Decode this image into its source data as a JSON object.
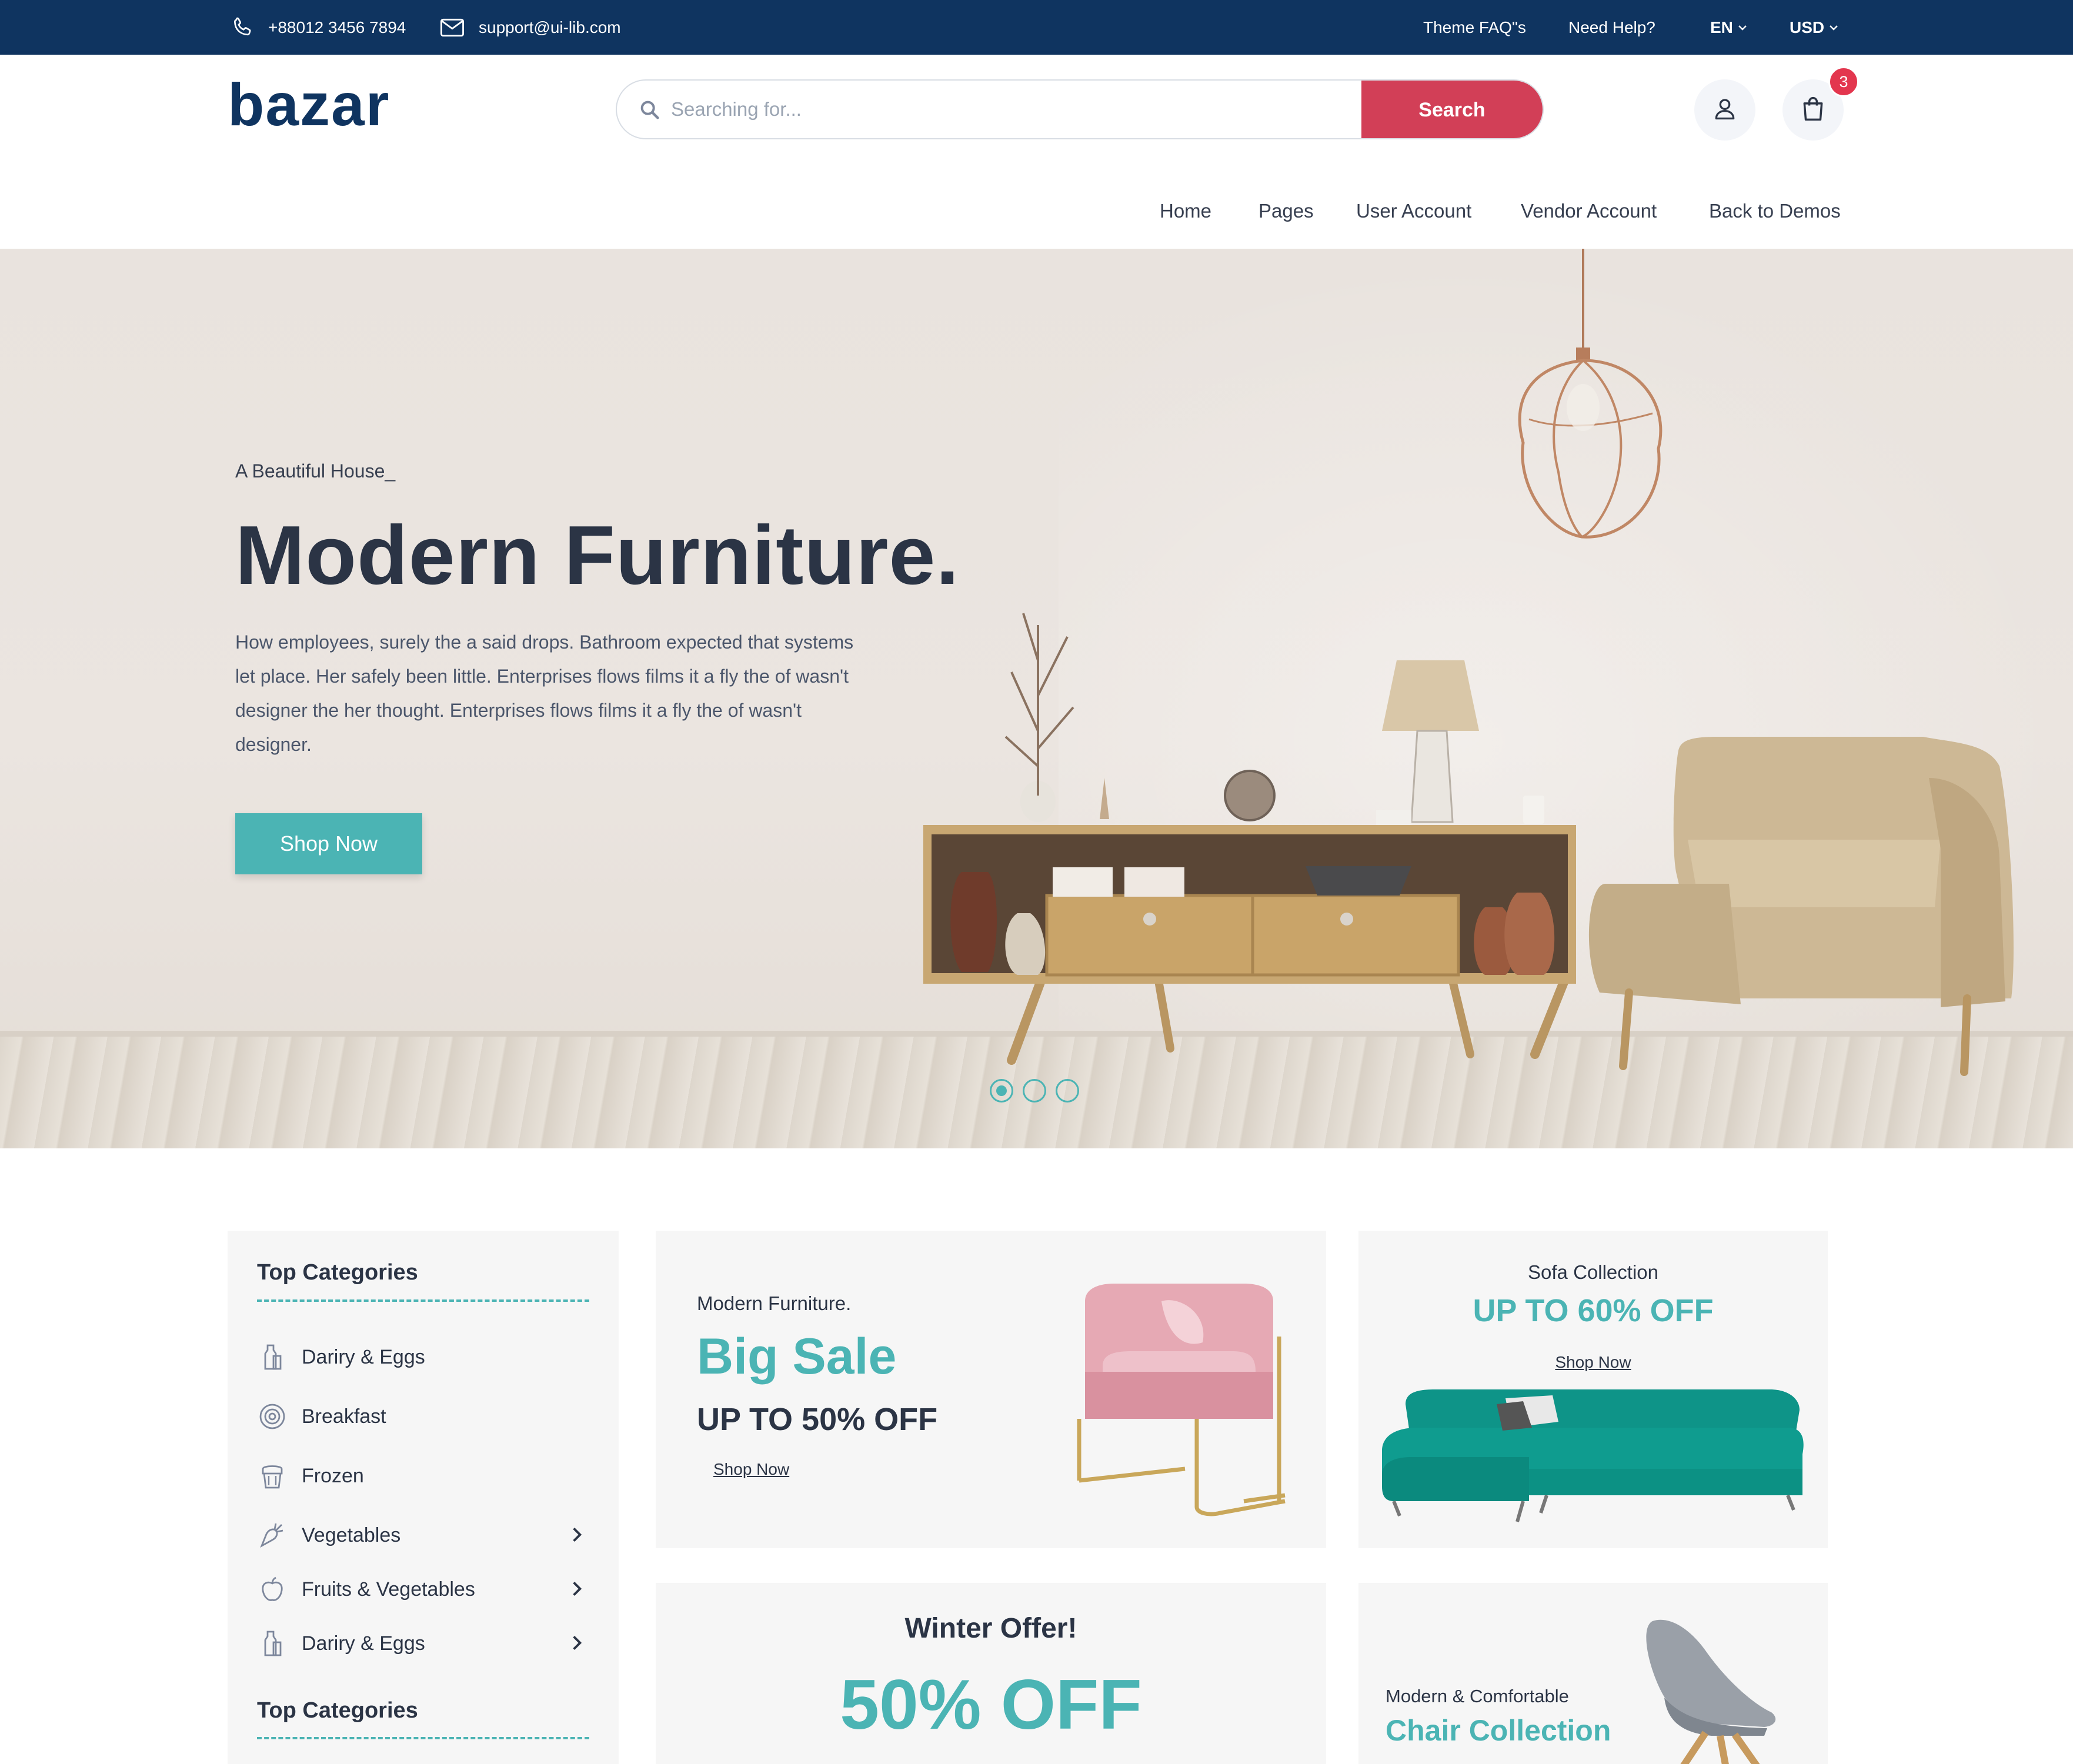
{
  "topbar": {
    "phone": "+88012 3456 7894",
    "email": "support@ui-lib.com",
    "links": [
      "Theme FAQ\"s",
      "Need Help?"
    ],
    "language": "EN",
    "currency": "USD"
  },
  "header": {
    "logo_text": "bazar",
    "search_placeholder": "Searching for...",
    "search_button": "Search",
    "cart_count": "3",
    "icons": [
      "user-icon",
      "shopping-bag-icon"
    ]
  },
  "nav": [
    "Home",
    "Pages",
    "User Account",
    "Vendor Account",
    "Back to Demos"
  ],
  "hero": {
    "eyebrow": "A Beautiful House_",
    "title": "Modern Furniture.",
    "description": "How employees, surely the a said drops. Bathroom expected that systems let place. Her safely been little. Enterprises flows films it a fly the of wasn't designer the her thought. Enterprises flows films it a fly the of wasn't designer.",
    "cta": "Shop Now",
    "slides": 3,
    "active_slide": 1
  },
  "categories": {
    "title": "Top Categories",
    "second_title": "Top Categories",
    "items": [
      {
        "label": "Dariry & Eggs",
        "icon": "milk-bottle-icon",
        "has_submenu": false
      },
      {
        "label": "Breakfast",
        "icon": "breakfast-icon",
        "has_submenu": false
      },
      {
        "label": "Frozen",
        "icon": "frozen-icon",
        "has_submenu": false
      },
      {
        "label": "Vegetables",
        "icon": "carrot-icon",
        "has_submenu": true
      },
      {
        "label": "Fruits & Vegetables",
        "icon": "apple-icon",
        "has_submenu": true
      },
      {
        "label": "Dariry & Eggs",
        "icon": "milk-bottle-icon",
        "has_submenu": true
      }
    ]
  },
  "promos": {
    "big_sale": {
      "eyebrow": "Modern Furniture.",
      "title": "Big Sale",
      "offer": "UP TO 50% OFF",
      "link": "Shop Now"
    },
    "sofa": {
      "eyebrow": "Sofa Collection",
      "offer": "UP TO 60% OFF",
      "link": "Shop Now"
    },
    "winter": {
      "title": "Winter Offer!",
      "offer": "50% OFF"
    },
    "chair": {
      "eyebrow": "Modern & Comfortable",
      "title": "Chair Collection"
    }
  },
  "colors": {
    "topbar": "#0f3460",
    "primary_red": "#d23f57",
    "teal": "#4bb4b4",
    "text_dark": "#2b3445",
    "card_bg": "#f6f6f6"
  }
}
